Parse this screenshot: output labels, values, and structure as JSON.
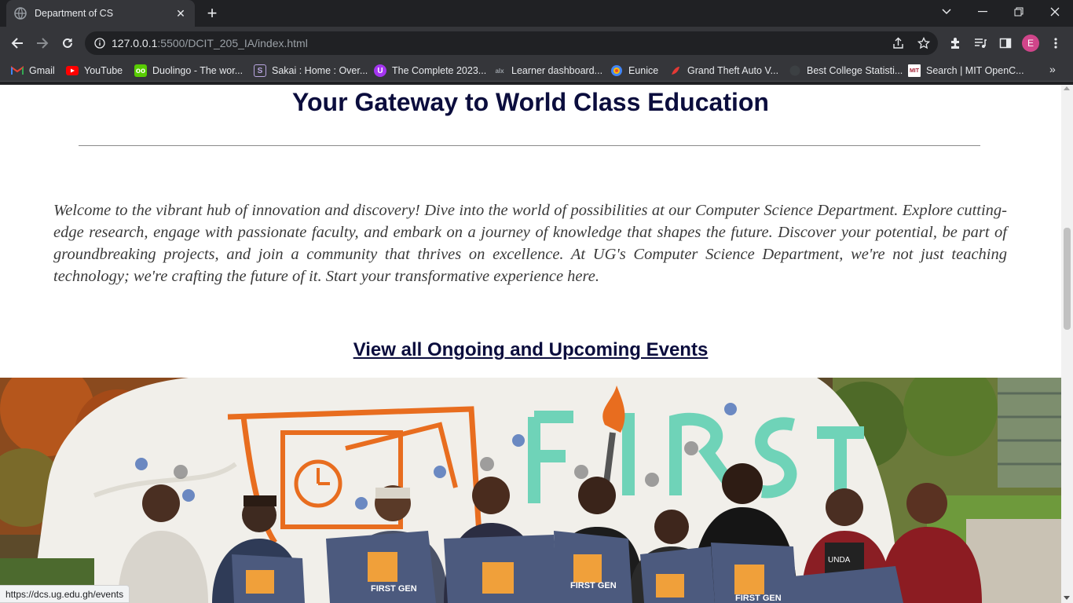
{
  "browser": {
    "tab_title": "Department of CS",
    "url_host": "127.0.0.1",
    "url_rest": ":5500/DCIT_205_IA/index.html",
    "avatar_letter": "E"
  },
  "bookmarks": [
    {
      "label": "Gmail",
      "icon": "gmail-icon",
      "color": "#ea4335"
    },
    {
      "label": "YouTube",
      "icon": "youtube-icon",
      "color": "#ff0000"
    },
    {
      "label": "Duolingo - The wor...",
      "icon": "duolingo-icon",
      "color": "#58cc02"
    },
    {
      "label": "Sakai : Home : Over...",
      "icon": "sakai-icon",
      "color": "#4b2e83"
    },
    {
      "label": "The Complete 2023...",
      "icon": "udemy-icon",
      "color": "#a435f0"
    },
    {
      "label": "Learner dashboard...",
      "icon": "alx-icon",
      "color": "#555555"
    },
    {
      "label": "Eunice",
      "icon": "eunice-icon",
      "color": "#4285f4"
    },
    {
      "label": "Grand Theft Auto V...",
      "icon": "gta-icon",
      "color": "#e53935"
    },
    {
      "label": "Best College Statisti...",
      "icon": "globe-icon",
      "color": "#5f6368"
    },
    {
      "label": "Search | MIT OpenC...",
      "icon": "mit-icon",
      "color": "#a31f34"
    }
  ],
  "page": {
    "heading": "Your Gateway to World Class Education",
    "intro": "Welcome to the vibrant hub of innovation and discovery! Dive into the world of possibilities at our Computer Science Department. Explore cutting-edge research, engage with passionate faculty, and embark on a journey of knowledge that shapes the future. Discover your potential, be part of groundbreaking projects, and join a community that thrives on excellence. At UG's Computer Science Department, we're not just teaching technology; we're crafting the future of it. Start your transformative experience here.",
    "events_link": "View all Ongoing and Upcoming Events",
    "photo_shirt_text": "FIRST GEN",
    "photo_rock_text": "FIRST",
    "photo_caption_text": "UNDA"
  },
  "status_url": "https://dcs.ug.edu.gh/events"
}
